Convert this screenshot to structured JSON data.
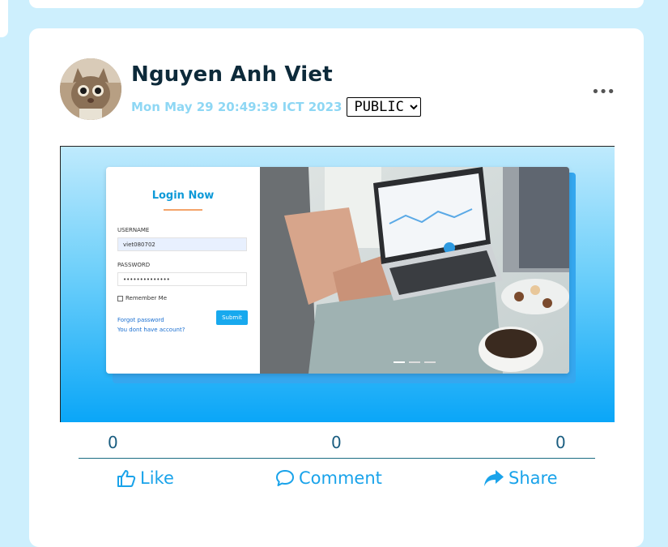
{
  "post": {
    "author": "Nguyen Anh Viet",
    "timestamp": "Mon May 29 20:49:39 ICT 2023",
    "privacy": {
      "selected": "PUBLIC"
    },
    "more_label": "•••",
    "image": {
      "login_title": "Login Now",
      "username_label": "USERNAME",
      "username_value": "viet080702",
      "password_label": "PASSWORD",
      "password_value": "••••••••••••••",
      "remember_label": "Remember Me",
      "forgot_link": "Forgot password",
      "signup_link": "You dont have account?",
      "submit_label": "Submit"
    },
    "stats": {
      "likes": "0",
      "comments": "0",
      "shares": "0"
    },
    "actions": {
      "like": "Like",
      "comment": "Comment",
      "share": "Share"
    }
  },
  "colors": {
    "page_bg": "#cdeffd",
    "accent": "#1aa3ea",
    "author": "#0d2a3a",
    "timestamp": "#8ed7f4"
  },
  "icons": {
    "more": "more-dots-icon",
    "like": "thumbs-up-icon",
    "comment": "comment-bubble-icon",
    "share": "share-arrow-icon"
  }
}
